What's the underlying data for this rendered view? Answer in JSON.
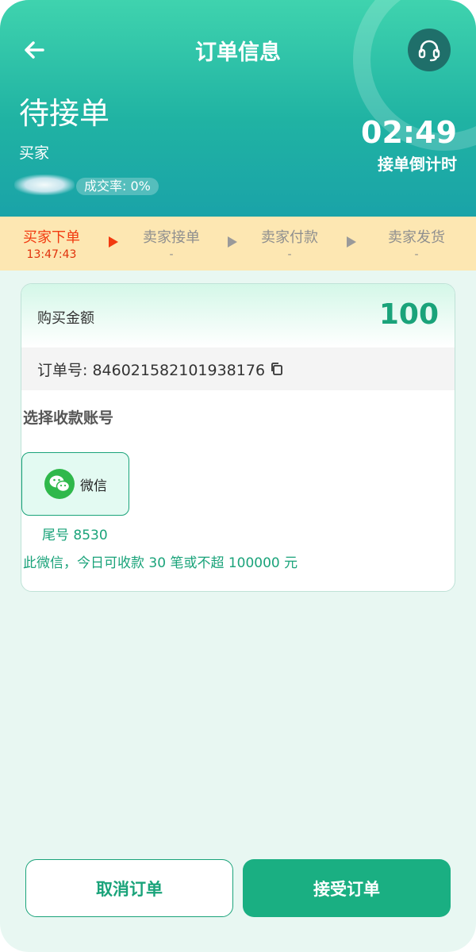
{
  "header": {
    "title": "订单信息",
    "status": "待接单",
    "role": "买家",
    "success_rate": "成交率: 0%",
    "countdown": "02:49",
    "countdown_label": "接单倒计时"
  },
  "steps": [
    {
      "name": "买家下单",
      "time": "13:47:43",
      "active": true
    },
    {
      "name": "卖家接单",
      "time": "-",
      "active": false
    },
    {
      "name": "卖家付款",
      "time": "-",
      "active": false
    },
    {
      "name": "卖家发货",
      "time": "-",
      "active": false
    }
  ],
  "order": {
    "amount_label": "购买金额",
    "amount": "100",
    "order_no": "订单号: 846021582101938176",
    "select_label": "选择收款账号",
    "payment_method": "微信",
    "tail": "尾号 8530",
    "limit_text": "此微信，今日可收款 30 笔或不超 100000 元"
  },
  "actions": {
    "cancel": "取消订单",
    "accept": "接受订单"
  },
  "colors": {
    "accent": "#1aa37a",
    "active_step": "#f23a10",
    "steps_bg": "#fde7b2"
  },
  "icons": [
    "back-arrow-icon",
    "headset-icon",
    "copy-icon",
    "wechat-icon"
  ]
}
